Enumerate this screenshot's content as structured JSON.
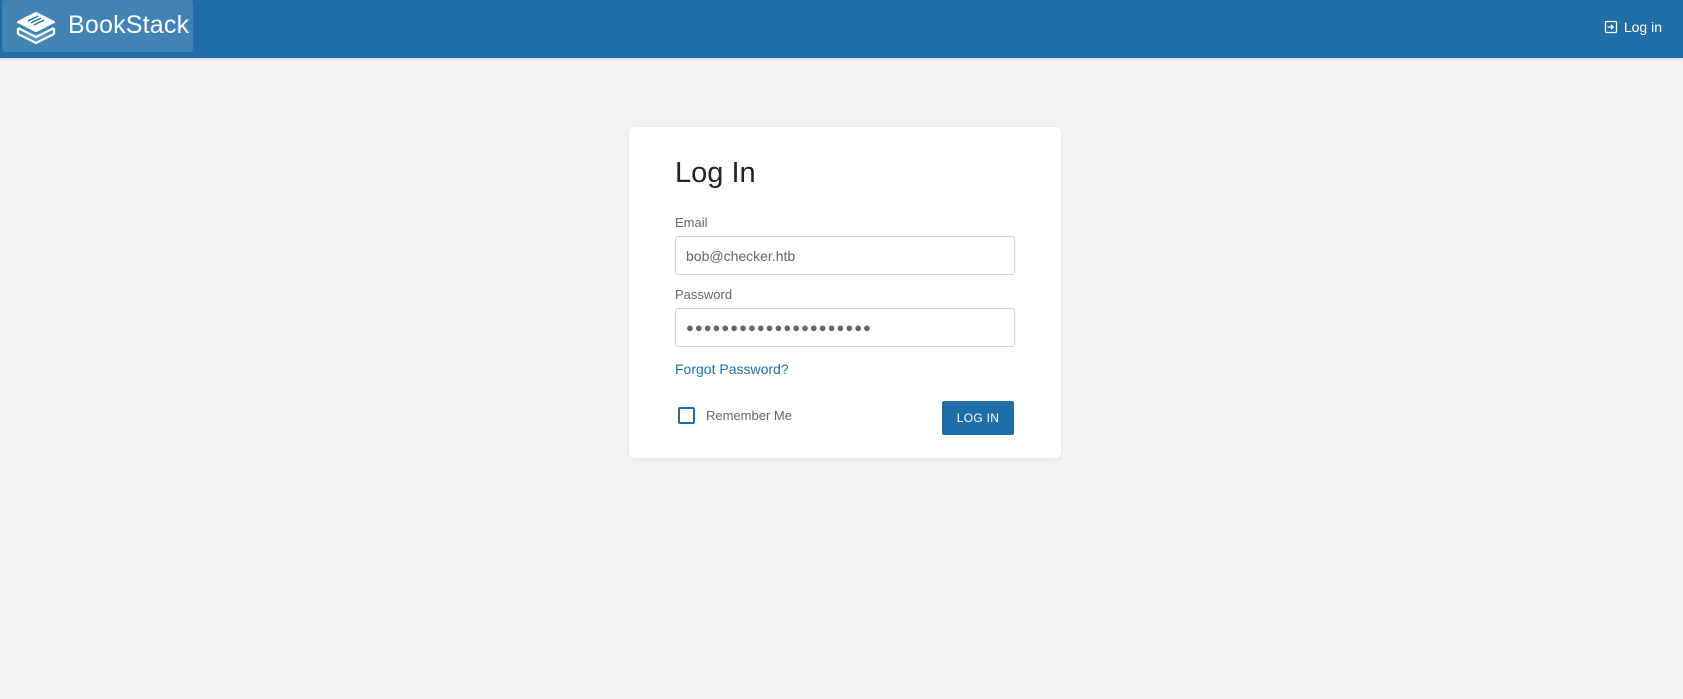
{
  "header": {
    "app_name": "BookStack",
    "login_label": "Log in",
    "login_icon": "login-icon",
    "logo_icon": "books-stack-icon"
  },
  "login_form": {
    "title": "Log In",
    "email_label": "Email",
    "email_value": "bob@checker.htb",
    "password_label": "Password",
    "password_value": "●●●●●●●●●●●●●●●●●●●●●",
    "forgot_label": "Forgot Password?",
    "remember_label": "Remember Me",
    "remember_checked": false,
    "submit_label": "LOG IN"
  },
  "colors": {
    "primary": "#206ea7",
    "background": "#f2f2f2",
    "card": "#ffffff"
  }
}
